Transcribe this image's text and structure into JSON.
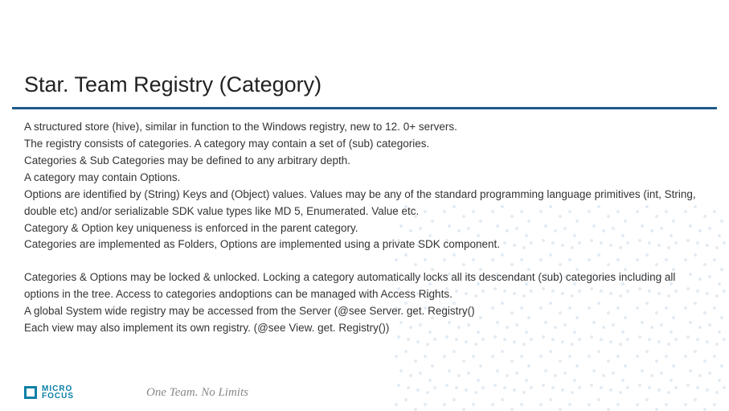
{
  "title": "Star. Team Registry (Category)",
  "body": {
    "p1": "A structured store (hive), similar in function to the Windows registry, new to 12. 0+ servers.",
    "p2": "The registry consists of categories. A category may contain a set of (sub) categories.",
    "p3": "Categories & Sub Categories may be defined to any arbitrary depth.",
    "p4": "A category may contain Options.",
    "p5": "Options are identified by (String) Keys and (Object) values. Values may be any of the standard programming language primitives (int, String, double etc) and/or serializable SDK value types like MD 5, Enumerated. Value etc.",
    "p6": "Category & Option key uniqueness is enforced in the parent category.",
    "p7": "Categories are implemented as Folders, Options are implemented using a private SDK component.",
    "p8": "Categories & Options may be locked & unlocked. Locking a category automatically locks all its descendant (sub) categories including all options in the tree. Access to categories andoptions can be managed with Access Rights.",
    "p9": "A global System wide registry may be accessed from the Server (@see Server. get. Registry()",
    "p10": "Each view may also implement its own registry. (@see View. get. Registry())"
  },
  "footer": {
    "logo_line1": "MICRO",
    "logo_line2": "FOCUS",
    "tagline": "One Team. No Limits"
  },
  "colors": {
    "divider": "#1f5a8a",
    "logo": "#0a7fa6"
  }
}
